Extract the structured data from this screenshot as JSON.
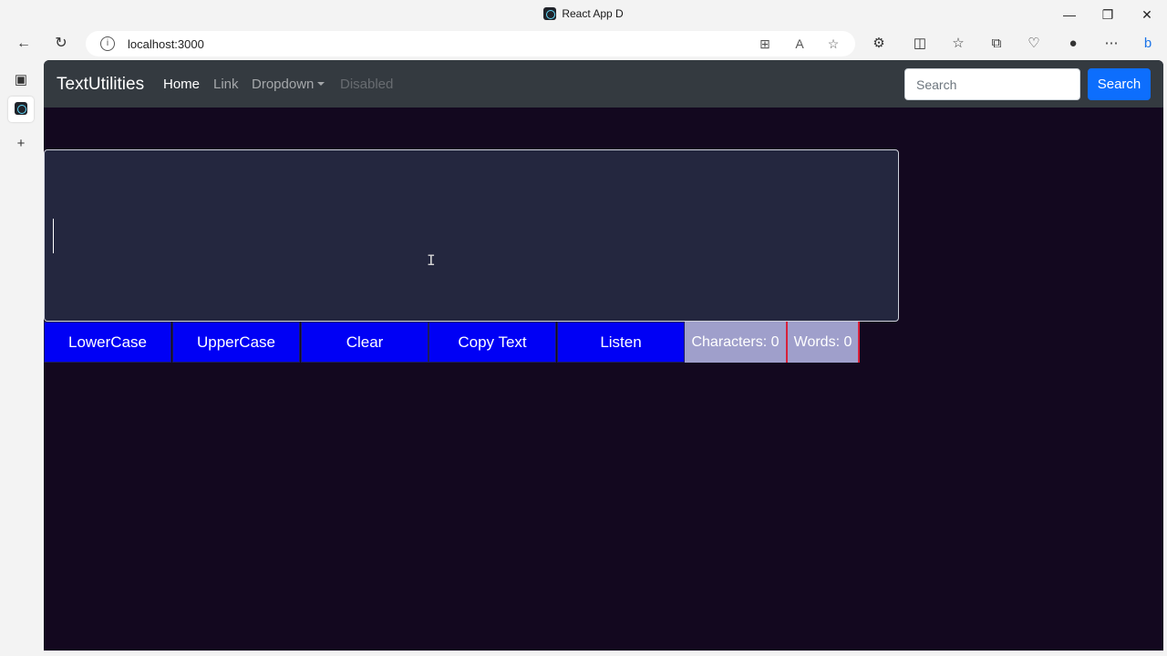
{
  "window": {
    "title": "React App D",
    "minimize": "—",
    "restore": "❐",
    "close": "✕"
  },
  "browser": {
    "back": "←",
    "refresh": "↻",
    "url": "localhost:3000",
    "info": "i"
  },
  "navbar": {
    "brand": "TextUtilities",
    "links": [
      "Home",
      "Link",
      "Dropdown",
      "Disabled"
    ],
    "search_placeholder": "Search",
    "search_button": "Search"
  },
  "editor": {
    "value": ""
  },
  "actions": [
    "LowerCase",
    "UpperCase",
    "Clear",
    "Copy Text",
    "Listen"
  ],
  "stats": {
    "characters": "Characters: 0",
    "words": "Words: 0"
  },
  "colors": {
    "page_bg": "#13081f",
    "textarea_bg": "#24273f",
    "button_bg": "#0000f5",
    "stat_bg": "#9f9fcb",
    "navbar_bg": "#343a40",
    "search_button_bg": "#0d6efd"
  }
}
